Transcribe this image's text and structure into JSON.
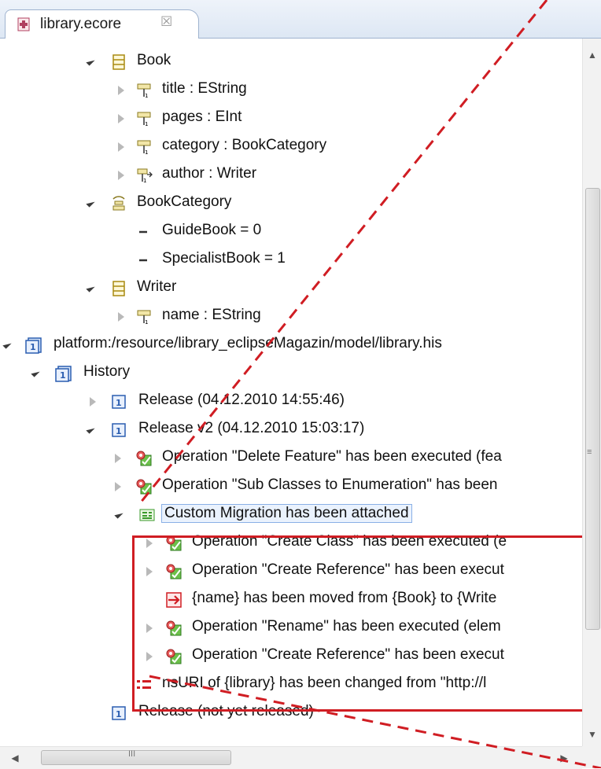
{
  "tab": {
    "title": "library.ecore",
    "close_glyph": "☒"
  },
  "tree": {
    "book": {
      "label": "Book"
    },
    "book_title": {
      "label": "title : EString"
    },
    "book_pages": {
      "label": "pages : EInt"
    },
    "book_category": {
      "label": "category : BookCategory"
    },
    "book_author": {
      "label": "author : Writer"
    },
    "bookcategory": {
      "label": "BookCategory"
    },
    "guidebook": {
      "label": "GuideBook = 0"
    },
    "specialistbook": {
      "label": "SpecialistBook = 1"
    },
    "writer": {
      "label": "Writer"
    },
    "writer_name": {
      "label": "name : EString"
    },
    "history_resource": {
      "label": "platform:/resource/library_eclipseMagazin/model/library.his"
    },
    "history": {
      "label": "History"
    },
    "release1": {
      "label": "Release (04.12.2010 14:55:46)"
    },
    "release_v2": {
      "label": "Release v2 (04.12.2010 15:03:17)"
    },
    "op_delete_feature": {
      "label": "Operation \"Delete Feature\" has been executed (fea"
    },
    "op_subclasses": {
      "label": "Operation \"Sub Classes to Enumeration\" has been"
    },
    "custom_migration": {
      "label": "Custom Migration has been attached"
    },
    "op_create_class": {
      "label": "Operation \"Create Class\" has been executed (e"
    },
    "op_create_reference_1": {
      "label": "Operation \"Create Reference\" has been execut"
    },
    "moved_name": {
      "label": "{name} has been moved from {Book} to {Write"
    },
    "op_rename": {
      "label": "Operation \"Rename\" has been executed (elem"
    },
    "op_create_reference_2": {
      "label": "Operation \"Create Reference\" has been execut"
    },
    "nsuri_changed": {
      "label": "nsURI of {library} has been changed from \"http://l"
    },
    "release_unreleased": {
      "label": "Release (not yet released)"
    }
  },
  "colors": {
    "highlight": "#d01d23",
    "selection_border": "#8ab0e6",
    "release_icon": "#2a5db0",
    "operation_icon": "#3a9a2a"
  },
  "scrollbar": {
    "grip": "≡",
    "hgrip": "III"
  }
}
